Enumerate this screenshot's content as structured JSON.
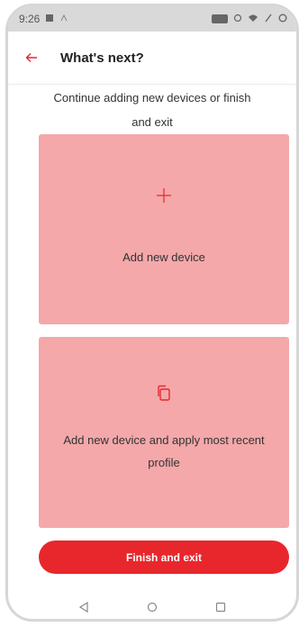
{
  "status_bar": {
    "time": "9:26",
    "left_icons": [
      "notification-icon",
      "signal-small-icon"
    ],
    "right_icons": [
      "data-badge-icon",
      "alarm-icon",
      "wifi-icon",
      "battery-icon"
    ]
  },
  "app_bar": {
    "back_icon": "arrow-left-icon",
    "title": "What's next?"
  },
  "subtitle": "Continue adding new devices or finish and exit",
  "options": [
    {
      "icon": "plus-icon",
      "label": "Add new device"
    },
    {
      "icon": "copy-icon",
      "label": "Add new device and apply most recent profile"
    }
  ],
  "finish_button": {
    "label": "Finish and exit"
  },
  "colors": {
    "accent": "#e8272c",
    "card_background": "#f4a8aa",
    "status_bar": "#d9d9d9"
  },
  "nav_bar": {
    "icons": [
      "back-triangle-icon",
      "home-circle-icon",
      "recents-square-icon"
    ]
  }
}
